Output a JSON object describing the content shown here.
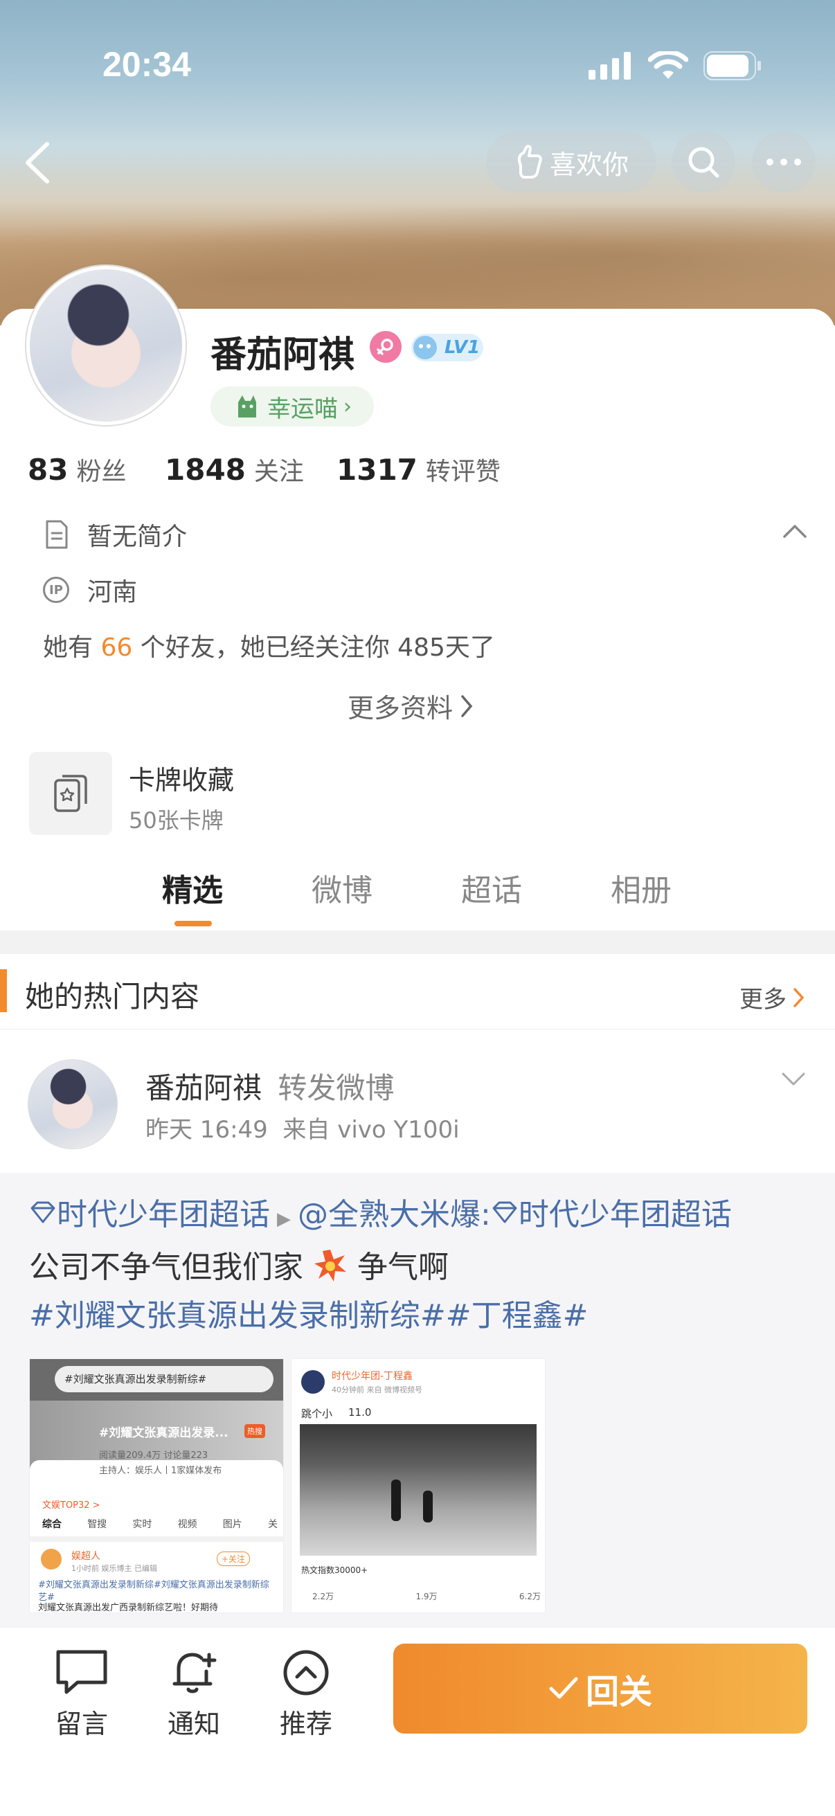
{
  "status": {
    "time": "20:34"
  },
  "header": {
    "like_label": "喜欢你"
  },
  "profile": {
    "name": "番茄阿祺",
    "level": "LV1",
    "lucky_label": "幸运喵",
    "stats": [
      {
        "num": "83",
        "label": "粉丝"
      },
      {
        "num": "1848",
        "label": "关注"
      },
      {
        "num": "1317",
        "label": "转评赞"
      }
    ],
    "bio": "暂无简介",
    "ip_badge": "IP",
    "location": "河南",
    "friends_prefix": "她有",
    "friends_count": "66",
    "friends_suffix": "个好友，她已经关注你 485天了",
    "more_info": "更多资料"
  },
  "cards": {
    "title": "卡牌收藏",
    "subtitle": "50张卡牌"
  },
  "tabs": [
    "精选",
    "微博",
    "超话",
    "相册"
  ],
  "hot": {
    "title": "她的热门内容",
    "more": "更多"
  },
  "post": {
    "author": "番茄阿祺",
    "action": "转发微博",
    "time_source": "昨天 16:49  来自 vivo Y100i",
    "topic1": "时代少年团超话",
    "mention": "@全熟大米爆:",
    "topic2": "时代少年团超话",
    "line2": "公司不争气但我们家",
    "line2_end": "争气啊",
    "hashtags": "#刘耀文张真源出发录制新综##丁程鑫#"
  },
  "thumb1": {
    "search": "#刘耀文张真源出发录制新综#",
    "title": "#刘耀文张真源出发录...",
    "hot": "热搜",
    "reads": "阅读量209.4万  讨论量223",
    "host": "主持人：娱乐人丨1家媒体发布",
    "rank": "文娱TOP32 >",
    "tabs": [
      "综合",
      "智搜",
      "实时",
      "视频",
      "图片",
      "关"
    ],
    "user": "娱超人",
    "follow": "+关注",
    "meta": "1小时前  娱乐博主  已编辑",
    "text1": "#刘耀文张真源出发录制新综#刘耀文张真源出发录制新综艺#",
    "text2": "刘耀文张真源出发广西录制新综艺啦！好期待"
  },
  "thumb2": {
    "user": "时代少年团-丁程鑫",
    "meta": "40分钟前  来自 微博视频号",
    "text": "跳个小",
    "date": "11.0",
    "hot": "热文指数30000+",
    "stats": [
      "2.2万",
      "1.9万",
      "6.2万"
    ]
  },
  "bottom": {
    "comment": "留言",
    "notify": "通知",
    "recommend": "推荐",
    "follow_back": "回关"
  },
  "colors": {
    "accent": "#f28a2e",
    "link": "#4a6ea8"
  }
}
